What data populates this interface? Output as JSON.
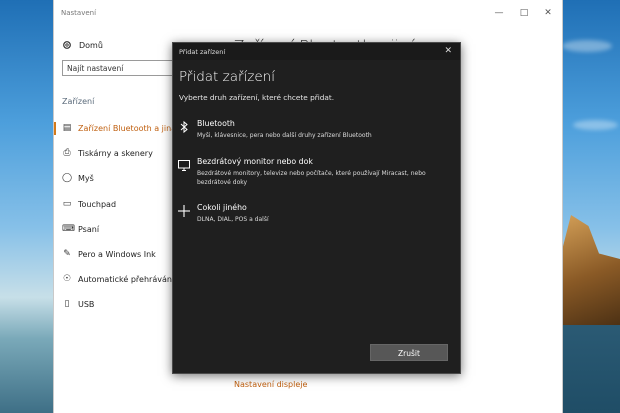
{
  "settings": {
    "window_title": "Nastavení",
    "home_label": "Domů",
    "search_placeholder": "Najít nastavení",
    "section_heading": "Zařízení",
    "page_title": "Zařízení Bluetooth a jiná",
    "nav": [
      {
        "label": "Zařízení Bluetooth a jiná",
        "icon": "bluetooth-devices-icon",
        "active": true
      },
      {
        "label": "Tiskárny a skenery",
        "icon": "printer-icon"
      },
      {
        "label": "Myš",
        "icon": "mouse-icon"
      },
      {
        "label": "Touchpad",
        "icon": "touchpad-icon"
      },
      {
        "label": "Psaní",
        "icon": "keyboard-icon"
      },
      {
        "label": "Pero a Windows Ink",
        "icon": "pen-icon"
      },
      {
        "label": "Automatické přehrávání",
        "icon": "autoplay-icon"
      },
      {
        "label": "USB",
        "icon": "usb-icon"
      }
    ],
    "bottom_link": "Nastavení displeje"
  },
  "dialog": {
    "window_title": "Přidat zařízení",
    "heading": "Přidat zařízení",
    "subtitle": "Vyberte druh zařízení, které chcete přidat.",
    "options": [
      {
        "title": "Bluetooth",
        "desc": "Myši, klávesnice, pera nebo další druhy zařízení Bluetooth",
        "icon": "bluetooth-icon"
      },
      {
        "title": "Bezdrátový monitor nebo dok",
        "desc": "Bezdrátové monitory, televize nebo počítače, které používají Miracast, nebo bezdrátové doky",
        "icon": "monitor-icon"
      },
      {
        "title": "Cokoli jiného",
        "desc": "DLNA, DIAL, POS a další",
        "icon": "plus-icon"
      }
    ],
    "cancel_label": "Zrušit"
  },
  "colors": {
    "accent": "#c06010",
    "dialog_bg": "#1f1f1f",
    "button_bg": "#575757"
  }
}
